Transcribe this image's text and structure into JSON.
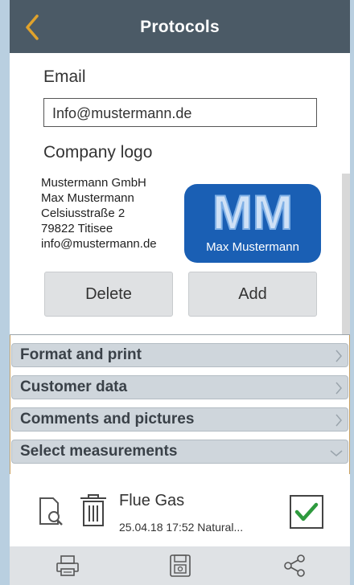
{
  "header": {
    "title": "Protocols",
    "back_icon": "chevron-left-icon",
    "accent": "#e0a22c"
  },
  "form": {
    "email_label": "Email",
    "email_value": "Info@mustermann.de",
    "logo_label": "Company logo",
    "address_lines": [
      "Mustermann GmbH",
      "Max Mustermann",
      "Celsiusstraße 2",
      "79822 Titisee",
      "info@mustermann.de"
    ],
    "logo": {
      "initials": "MM",
      "caption": "Max Mustermann",
      "color": "#1a5fb4"
    },
    "delete_label": "Delete",
    "add_label": "Add"
  },
  "sections": [
    {
      "label": "Format and print",
      "state": "collapsed"
    },
    {
      "label": "Customer data",
      "state": "collapsed"
    },
    {
      "label": "Comments and pictures",
      "state": "collapsed"
    },
    {
      "label": "Select measurements",
      "state": "expanded"
    }
  ],
  "measurement": {
    "title": "Flue Gas",
    "subtitle": "25.04.18  17:52  Natural...",
    "checked": true,
    "check_color": "#2e9a3e"
  },
  "toolbar": {
    "icons": [
      "print-icon",
      "save-icon",
      "share-icon"
    ]
  }
}
